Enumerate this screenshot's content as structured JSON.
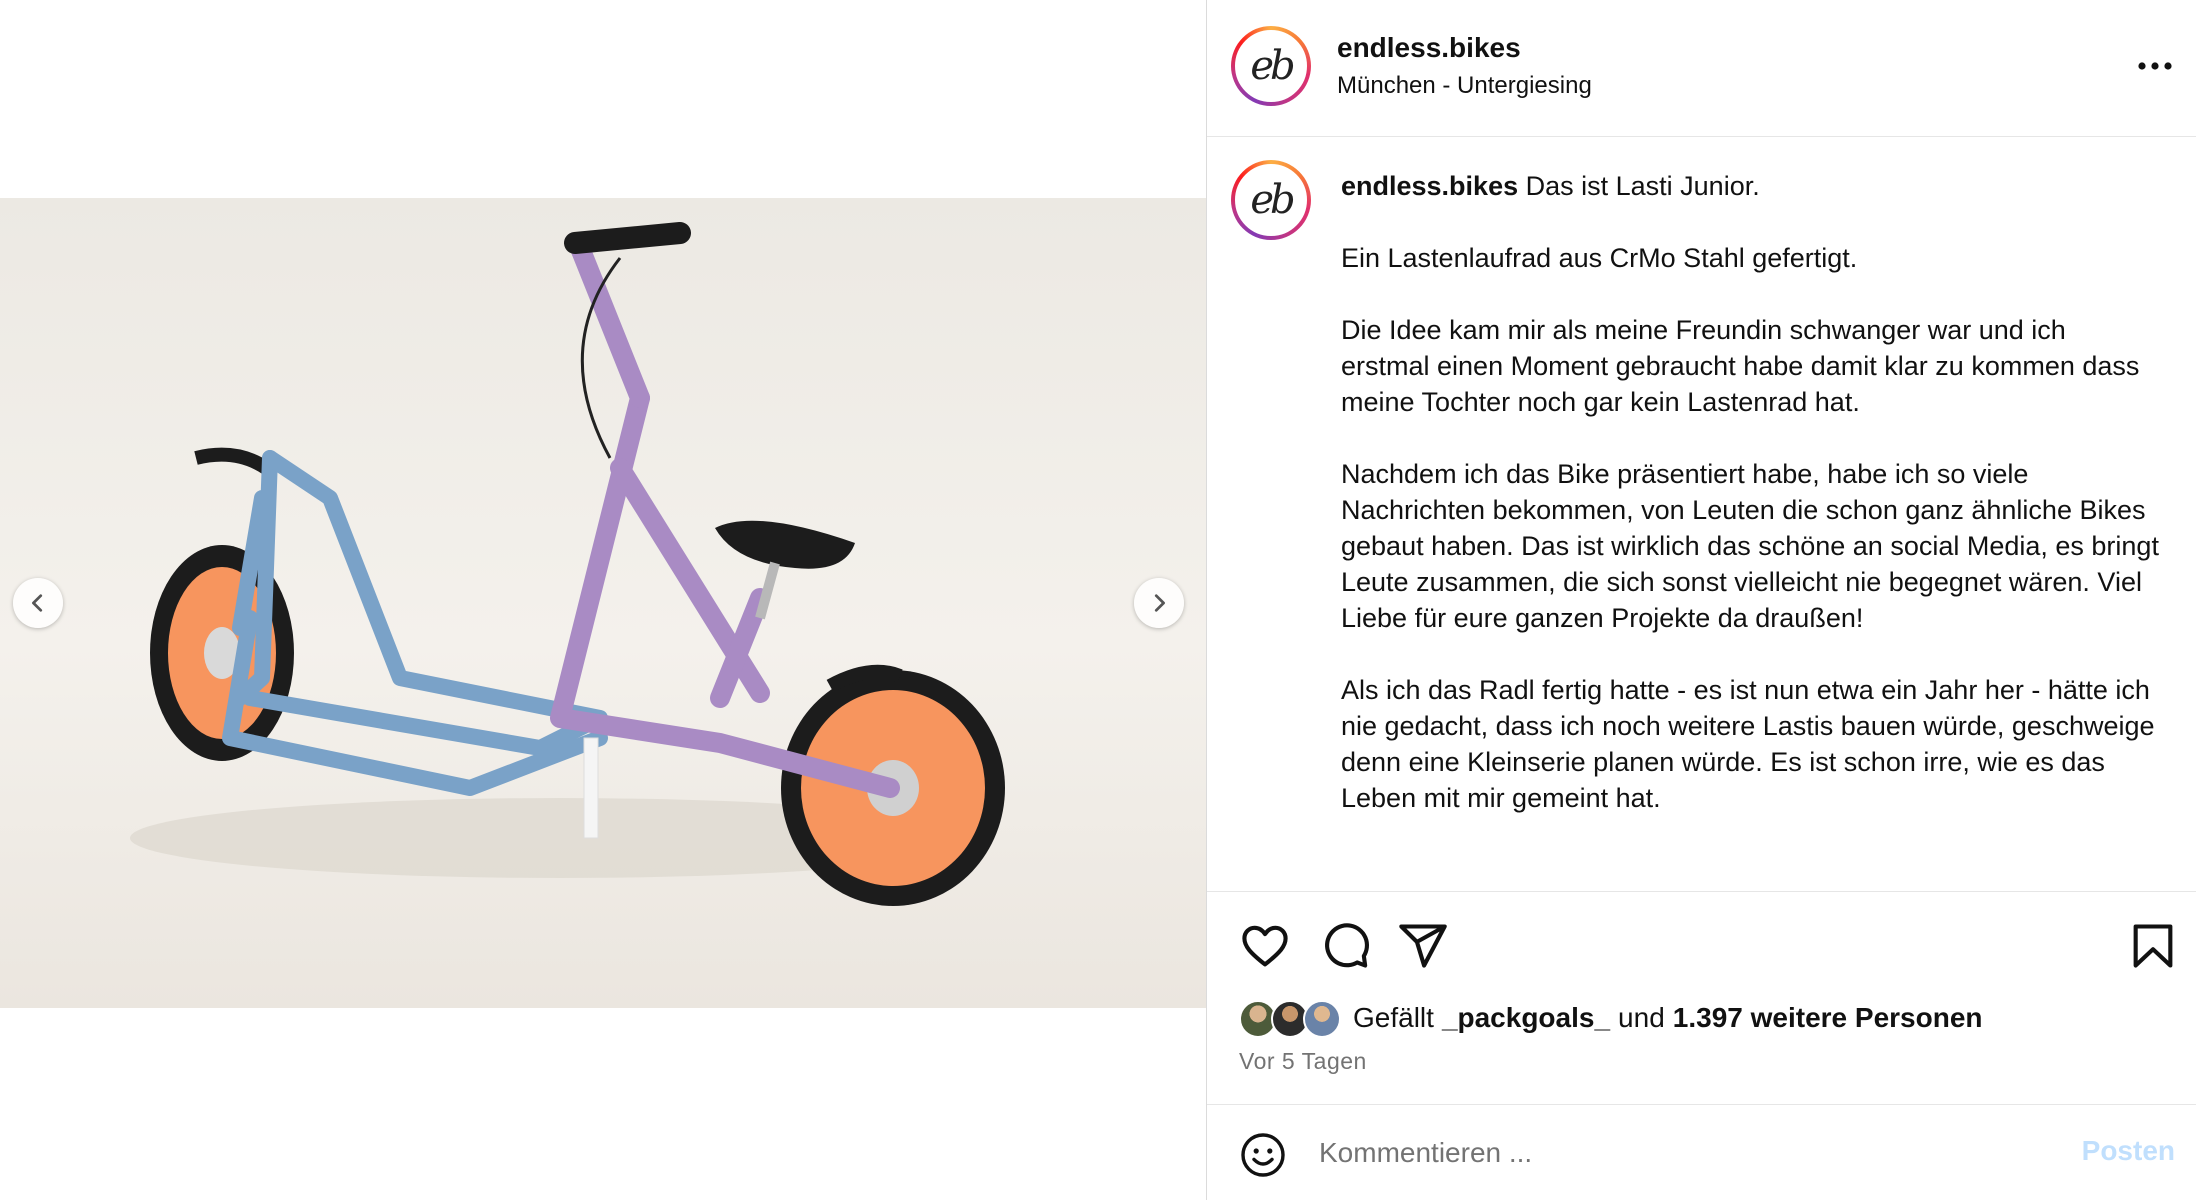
{
  "post": {
    "username": "endless.bikes",
    "location": "München - Untergiesing",
    "avatar_logo": "eb",
    "caption_text": " Das ist Lasti Junior.\n\nEin Lastenlaufrad aus CrMo Stahl gefertigt.\n\nDie Idee kam mir als meine Freundin schwanger war und ich erstmal einen Moment gebraucht habe damit klar zu kommen dass meine Tochter noch gar kein Lastenrad hat.\n\nNachdem ich das Bike präsentiert habe, habe ich so viele Nachrichten bekommen, von Leuten die schon ganz ähnliche Bikes gebaut haben. Das ist wirklich das schöne an social Media, es bringt Leute zusammen, die sich sonst vielleicht nie begegnet wären. Viel Liebe für eure ganzen Projekte da draußen!\n\nAls ich das Radl fertig hatte - es ist nun etwa ein Jahr her - hätte ich nie gedacht, dass ich noch weitere Lastis bauen würde, geschweige denn eine Kleinserie planen würde. Es ist schon irre, wie es das Leben mit mir gemeint hat."
  },
  "likes": {
    "prefix": "Gefällt",
    "user": "_packgoals_",
    "conj": "und",
    "count_text": "1.397 weitere Personen"
  },
  "timestamp": "Vor 5 Tagen",
  "comment": {
    "placeholder": "Kommentieren ...",
    "post_label": "Posten"
  },
  "icons": {
    "more": "more-horizontal-icon",
    "like": "heart-icon",
    "comment": "comment-bubble-icon",
    "share": "paper-plane-icon",
    "save": "bookmark-icon",
    "emoji": "smiley-icon",
    "prev": "chevron-left-icon",
    "next": "chevron-right-icon"
  },
  "colors": {
    "frame_purple": "#a98bc4",
    "cargo_blue": "#7aa2c8",
    "rim_orange": "#f7955e",
    "post_button_disabled": "#c0dffd",
    "muted_text": "#737373"
  }
}
